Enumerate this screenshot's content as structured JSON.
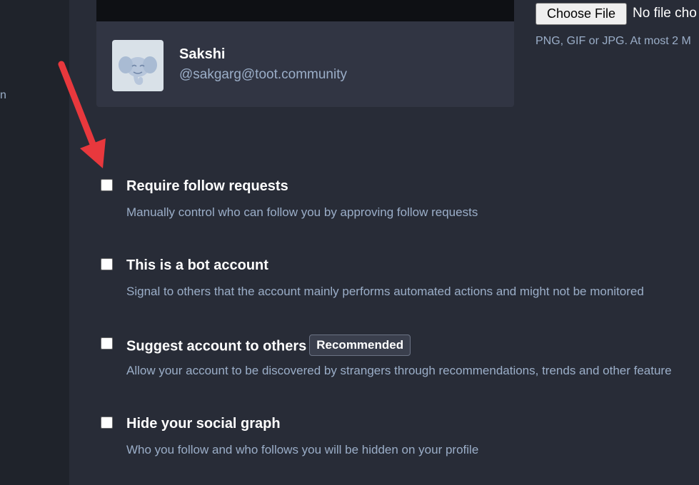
{
  "sidebar": {
    "partial_text": "n"
  },
  "profile_preview": {
    "display_name": "Sakshi",
    "handle": "@sakgarg@toot.community",
    "avatar_icon": "mastodon-elephant-icon"
  },
  "file_upload": {
    "button_label": "Choose File",
    "status": "No file cho",
    "hint": "PNG, GIF or JPG. At most 2 M"
  },
  "settings": [
    {
      "label": "Require follow requests",
      "hint": "Manually control who can follow you by approving follow requests",
      "checked": false
    },
    {
      "label": "This is a bot account",
      "hint": "Signal to others that the account mainly performs automated actions and might not be monitored",
      "checked": false
    },
    {
      "label": "Suggest account to others",
      "badge": "Recommended",
      "hint": "Allow your account to be discovered by strangers through recommendations, trends and other feature",
      "checked": false
    },
    {
      "label": "Hide your social graph",
      "hint": "Who you follow and who follows you will be hidden on your profile",
      "checked": false
    }
  ],
  "annotation": {
    "arrow_color": "#e8383d"
  },
  "colors": {
    "background": "#282c37",
    "sidebar": "#1f232b",
    "card": "#313543",
    "hint_text": "#9baec8"
  }
}
